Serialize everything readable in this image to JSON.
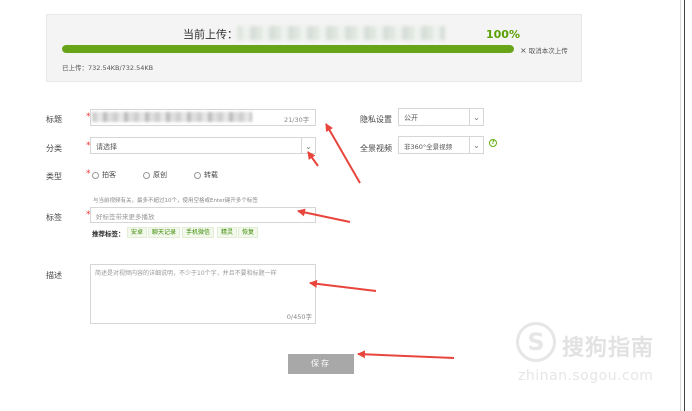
{
  "upload": {
    "title": "当前上传：",
    "percent_text": "100%",
    "progress": 1.0,
    "cancel_label": "取消本次上传",
    "uploaded_text": "已上传：732.54KB/732.54KB"
  },
  "form": {
    "title": {
      "label": "标题",
      "counter": "21/30字"
    },
    "category": {
      "label": "分类",
      "placeholder": "请选择"
    },
    "type": {
      "label": "类型",
      "options": [
        "拍客",
        "原创",
        "转载"
      ]
    },
    "tags": {
      "label": "标签",
      "hint": "与当前视频有关，最多不超过10个，使用空格或Enter键开多个标签",
      "placeholder": "好标签带来更多播放",
      "recommend_label": "推荐标签：",
      "recommended": [
        "安卓",
        "聊天记录",
        "手机微信",
        "精灵",
        "恢复"
      ]
    },
    "description": {
      "label": "描述",
      "placeholder": "简述是对视频内容的详细说明，不少于10个字，并且不要和标题一样",
      "counter": "0/450字"
    },
    "privacy": {
      "label": "隐私设置",
      "value": "公开"
    },
    "panorama": {
      "label": "全景视频",
      "value": "非360°全景视频",
      "help": "?"
    },
    "save_label": "保存"
  },
  "watermark": {
    "logo": "S",
    "text": "搜狗指南",
    "url": "zhinan.sogou.com"
  },
  "colors": {
    "accent": "#67a418",
    "required": "#e33333",
    "arrow": "#e8453c"
  }
}
